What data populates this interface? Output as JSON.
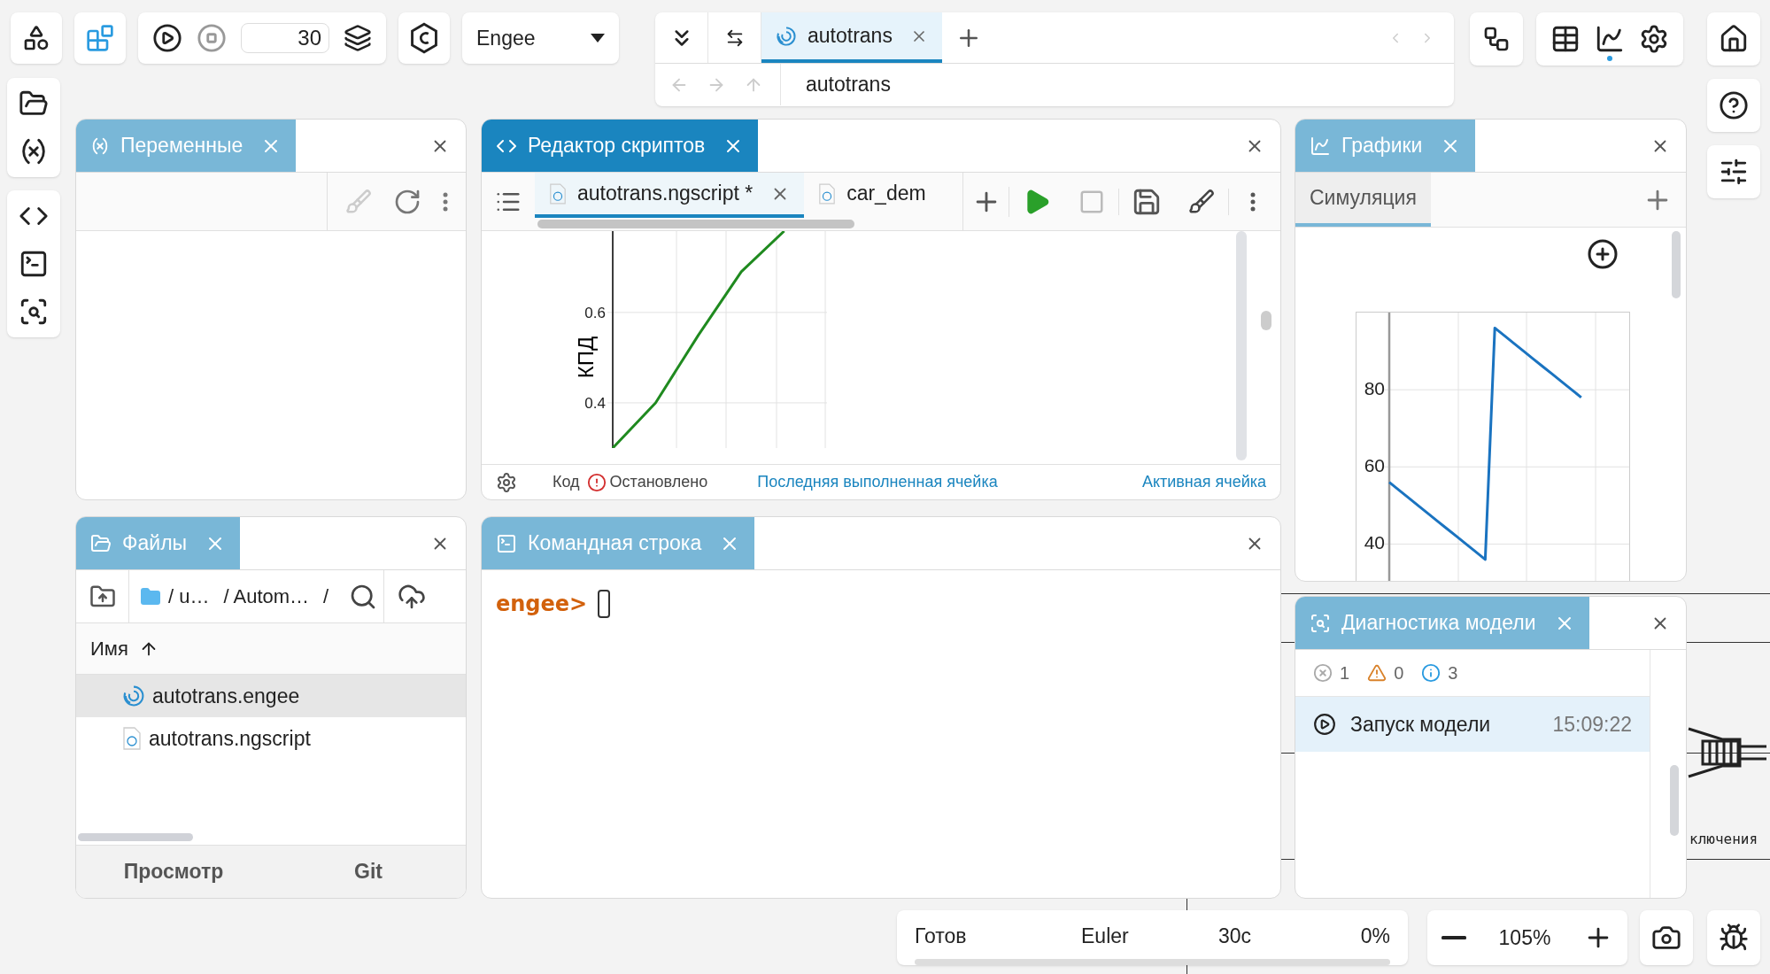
{
  "toolbar": {
    "sim_time": "30",
    "solver_select": "Engee"
  },
  "document_tabs": {
    "tabs": [
      {
        "label": "autotrans",
        "selected": true
      }
    ],
    "path": "autotrans"
  },
  "variables_panel": {
    "title": "Переменные",
    "active": false
  },
  "files_panel": {
    "title": "Файлы",
    "active": false,
    "breadcrumbs": [
      "/ u…",
      "/ Autom…",
      "/"
    ],
    "column": "Имя",
    "files": [
      {
        "name": "autotrans.engee",
        "kind": "model",
        "selected": true
      },
      {
        "name": "autotrans.ngscript",
        "kind": "script",
        "selected": false
      }
    ],
    "bottom_tabs": [
      {
        "label": "Просмотр"
      },
      {
        "label": "Git"
      }
    ]
  },
  "script_editor": {
    "title": "Редактор скриптов",
    "active": true,
    "tabs": [
      {
        "label": "autotrans.ngscript *",
        "selected": true,
        "closable": true
      },
      {
        "label": "car_dem",
        "selected": false,
        "closable": false
      }
    ],
    "chart_data": {
      "type": "line",
      "ylabel": "КПД",
      "ylim": [
        0.3,
        0.78
      ],
      "yticks": [
        0.4,
        0.6
      ],
      "grid": true,
      "series": [
        {
          "color": "#1f8a1f",
          "values": [
            0.3,
            0.4,
            0.55,
            0.69,
            0.78
          ]
        }
      ]
    },
    "status": {
      "mode": "Код",
      "state": "Остановлено",
      "last_cell": "Последняя выполненная ячейка",
      "active_cell": "Активная ячейка"
    }
  },
  "command_line": {
    "title": "Командная строка",
    "active": false,
    "prompt": "engee>"
  },
  "graphs": {
    "title": "Графики",
    "active": false,
    "tabs": [
      {
        "label": "Симуляция",
        "selected": true
      }
    ],
    "chart_data": {
      "type": "line",
      "ylim": [
        30,
        100
      ],
      "yticks": [
        40,
        60,
        80
      ],
      "grid": true,
      "categories": [
        null,
        null,
        null,
        null,
        null,
        null,
        null,
        null,
        null,
        null,
        null,
        null,
        null,
        null,
        null,
        null,
        null,
        null,
        null,
        null,
        null
      ],
      "series": [
        {
          "color": "#1a73c0",
          "values": [
            56,
            54,
            52,
            50,
            48,
            46,
            44,
            42,
            40,
            38,
            36,
            96,
            94,
            92,
            90,
            88,
            86,
            84,
            82,
            80,
            78
          ]
        }
      ]
    }
  },
  "diagnostics": {
    "title": "Диагностика модели",
    "active": false,
    "counts": [
      {
        "kind": "error",
        "value": "1"
      },
      {
        "kind": "warning",
        "value": "0"
      },
      {
        "kind": "info",
        "value": "3"
      }
    ],
    "entries": [
      {
        "label": "Запуск модели",
        "time": "15:09:22",
        "selected": true
      }
    ]
  },
  "status_bar": {
    "state": "Готов",
    "solver": "Euler",
    "time": "30с",
    "progress": "0%",
    "level": 0
  },
  "zoom": "105%",
  "canvas": {
    "label": "ключения"
  }
}
